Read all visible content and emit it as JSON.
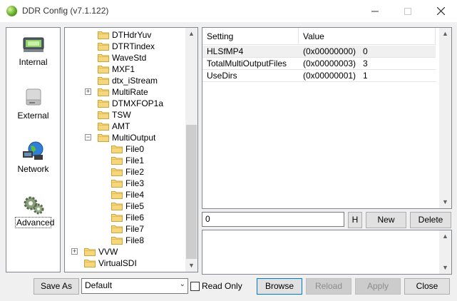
{
  "window": {
    "title": "DDR Config (v7.1.122)",
    "controls": {
      "minimize": "—",
      "maximize": "☐",
      "close": "✕"
    }
  },
  "sidebar": {
    "items": [
      {
        "label": "Internal",
        "icon": "internal-icon"
      },
      {
        "label": "External",
        "icon": "external-drive-icon"
      },
      {
        "label": "Network",
        "icon": "network-globe-icon"
      },
      {
        "label": "Advanced",
        "icon": "gears-icon",
        "selected": true
      }
    ]
  },
  "tree": {
    "nodes": [
      {
        "label": "DTHdrYuv"
      },
      {
        "label": "DTRTindex"
      },
      {
        "label": "WaveStd"
      },
      {
        "label": "MXF1"
      },
      {
        "label": "dtx_iStream"
      },
      {
        "label": "MultiRate",
        "expander": "+"
      },
      {
        "label": "DTMXFOP1a"
      },
      {
        "label": "TSW"
      },
      {
        "label": "AMT"
      },
      {
        "label": "MultiOutput",
        "expander": "−",
        "open": true
      },
      {
        "label": "File0"
      },
      {
        "label": "File1"
      },
      {
        "label": "File2"
      },
      {
        "label": "File3"
      },
      {
        "label": "File4"
      },
      {
        "label": "File5"
      },
      {
        "label": "File6"
      },
      {
        "label": "File7"
      },
      {
        "label": "File8"
      },
      {
        "label": "VVW",
        "expander": "+"
      },
      {
        "label": "VirtualSDI"
      }
    ],
    "scroll_up": "▲",
    "scroll_down": "▼"
  },
  "grid": {
    "columns": [
      "Setting",
      "Value"
    ],
    "rows": [
      {
        "setting": "HLSfMP4",
        "hex": "(0x00000000)",
        "value": "0",
        "selected": true
      },
      {
        "setting": "TotalMultiOutputFiles",
        "hex": "(0x00000003)",
        "value": "3"
      },
      {
        "setting": "UseDirs",
        "hex": "(0x00000001)",
        "value": "1"
      }
    ],
    "scroll_up": "▲",
    "scroll_down": "▼"
  },
  "editor": {
    "value": "0",
    "hex_button": "H",
    "new_button": "New",
    "delete_button": "Delete"
  },
  "description": {
    "scroll_up": "▲",
    "scroll_down": "▼"
  },
  "footer": {
    "save_as": "Save As",
    "profile_selected": "Default",
    "dropdown_arrow": "⌄",
    "read_only_label": "Read Only",
    "browse": "Browse",
    "reload": "Reload",
    "apply": "Apply",
    "close": "Close"
  },
  "colors": {
    "folder": "#f5d67a",
    "folder_outline": "#c9a53b",
    "window_bg": "#f0f0f0",
    "accent": "#0078d7"
  }
}
